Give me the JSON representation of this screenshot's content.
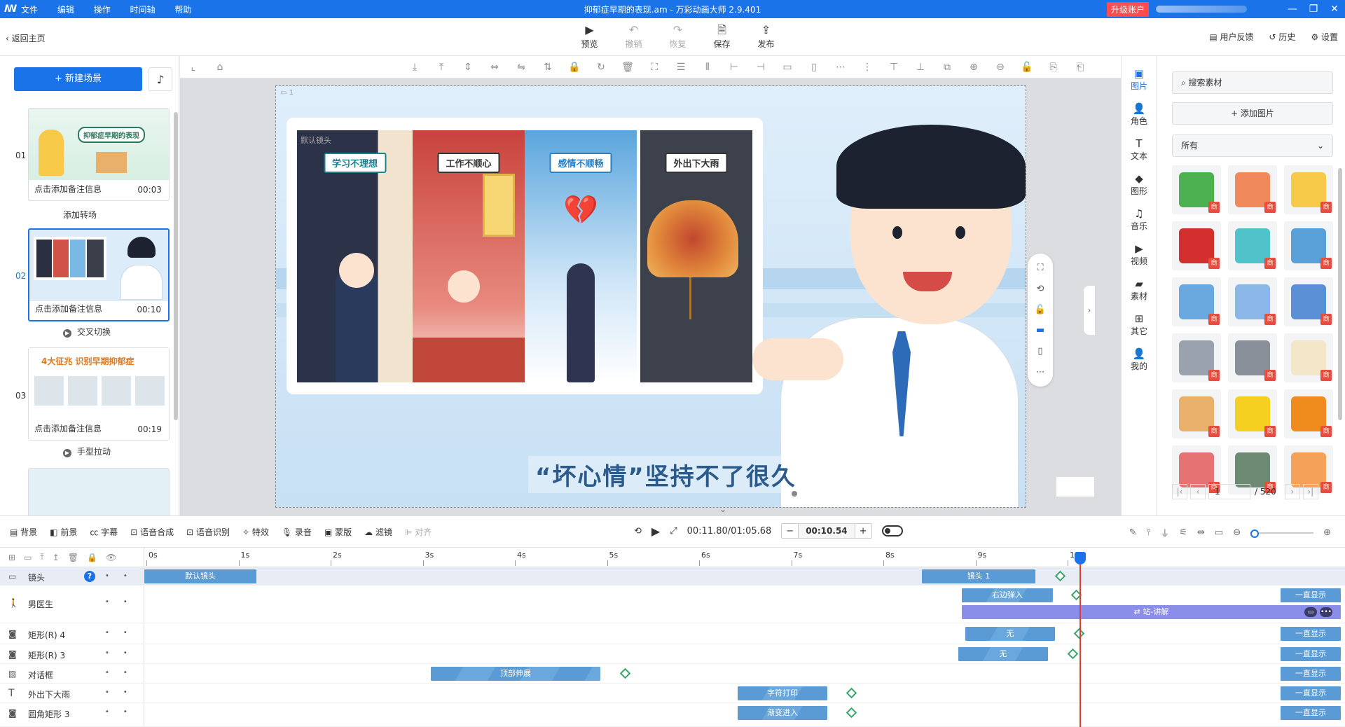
{
  "titlebar": {
    "menu": [
      "文件",
      "编辑",
      "操作",
      "时间轴",
      "帮助"
    ],
    "window_title": "抑郁症早期的表现.am - 万彩动画大师 2.9.401",
    "upgrade_label": "升级账户"
  },
  "topbar": {
    "back_label": "返回主页",
    "actions": {
      "preview": "预览",
      "undo": "撤销",
      "redo": "恢复",
      "save": "保存",
      "publish": "发布"
    },
    "right_links": {
      "feedback": "用户反馈",
      "history": "历史",
      "settings": "设置"
    }
  },
  "scenes": {
    "new_scene_label": "+ 新建场景",
    "items": [
      {
        "num": "01",
        "note": "点击添加备注信息",
        "duration": "00:03",
        "thumb_title": "抑郁症早期的表现"
      },
      {
        "num": "02",
        "note": "点击添加备注信息",
        "duration": "00:10"
      },
      {
        "num": "03",
        "note": "点击添加备注信息",
        "duration": "00:19",
        "thumb_title": "4大征兆 识别早期抑郁症"
      }
    ],
    "transitions": [
      "添加转场",
      "交叉切换",
      "手型拉动"
    ]
  },
  "stage": {
    "scene_index": "1",
    "camera_label": "默认镜头",
    "panels": [
      "学习不理想",
      "工作不顺心",
      "感情不顺畅",
      "外出下大雨"
    ],
    "caption": "“坏心情”坚持不了很久"
  },
  "icon_column": [
    {
      "label": "图片",
      "icon": "image-icon"
    },
    {
      "label": "角色",
      "icon": "person-icon"
    },
    {
      "label": "文本",
      "icon": "text-icon"
    },
    {
      "label": "图形",
      "icon": "shape-icon"
    },
    {
      "label": "音乐",
      "icon": "music-icon"
    },
    {
      "label": "视频",
      "icon": "video-icon"
    },
    {
      "label": "素材",
      "icon": "folder-icon"
    },
    {
      "label": "其它",
      "icon": "grid-icon"
    },
    {
      "label": "我的",
      "icon": "user-icon"
    }
  ],
  "assets": {
    "search_placeholder": "搜索素材",
    "add_image_label": "+ 添加图片",
    "filter_value": "所有",
    "badge": "商",
    "tile_colors": [
      "#4caf50",
      "#f08a5d",
      "#f7c948",
      "#d32f2f",
      "#4fc3c9",
      "#5aa0d8",
      "#6aa9e0",
      "#8ab6e8",
      "#5a8fd6",
      "#9aa3ad",
      "#8a9099",
      "#f3e6c9",
      "#e8b06a",
      "#f5d020",
      "#f08c1e",
      "#e57373",
      "#6d8b74",
      "#f4a259"
    ],
    "page_current": "1",
    "page_total": "/ 520"
  },
  "timeline_toolbar": {
    "tools": [
      "背景",
      "前景",
      "字幕",
      "语音合成",
      "语音识别",
      "特效",
      "录音",
      "蒙版",
      "滤镜",
      "对齐"
    ],
    "time_current": "00:11.80/01:05.68",
    "time_value": "00:10.54"
  },
  "timeline": {
    "ticks": [
      "0s",
      "1s",
      "2s",
      "3s",
      "4s",
      "5s",
      "6s",
      "7s",
      "8s",
      "9s",
      "10s"
    ],
    "tracks": [
      {
        "label": "镜头",
        "clips": [
          "默认镜头",
          "镜头 1"
        ]
      },
      {
        "label": "男医生",
        "clips": [
          "右边弹入",
          "一直显示",
          "站-讲解"
        ]
      },
      {
        "label": "矩形(R) 4",
        "clips": [
          "无",
          "一直显示"
        ]
      },
      {
        "label": "矩形(R) 3",
        "clips": [
          "无",
          "一直显示"
        ]
      },
      {
        "label": "对话框",
        "clips": [
          "顶部伸展",
          "一直显示"
        ]
      },
      {
        "label": "外出下大雨",
        "clips": [
          "字符打印",
          "一直显示"
        ]
      },
      {
        "label": "圆角矩形 3",
        "clips": [
          "渐变进入",
          "一直显示"
        ]
      }
    ]
  }
}
